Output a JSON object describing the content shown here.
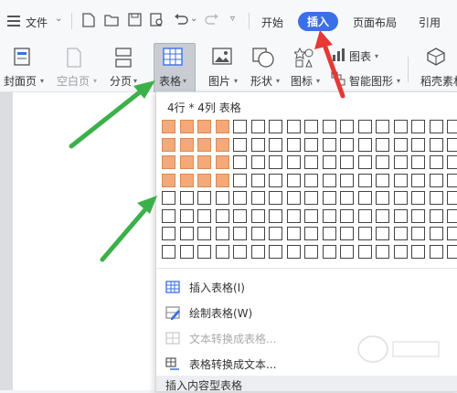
{
  "menubar": {
    "hamburger_icon": "hamburger-icon",
    "file_label": "文件",
    "tabs": [
      {
        "label": "开始",
        "active": false
      },
      {
        "label": "插入",
        "active": true
      },
      {
        "label": "页面布局",
        "active": false
      },
      {
        "label": "引用",
        "active": false
      }
    ]
  },
  "ribbon": {
    "items": [
      {
        "label": "封面页",
        "disabled": false,
        "icon": "cover-page-icon",
        "dropdown": true
      },
      {
        "label": "空白页",
        "disabled": true,
        "icon": "blank-page-icon",
        "dropdown": true
      },
      {
        "label": "分页",
        "disabled": false,
        "icon": "page-break-icon",
        "dropdown": true
      },
      {
        "label": "表格",
        "disabled": false,
        "icon": "table-icon",
        "dropdown": true,
        "selected": true
      },
      {
        "label": "图片",
        "disabled": false,
        "icon": "picture-icon",
        "dropdown": true
      },
      {
        "label": "形状",
        "disabled": false,
        "icon": "shape-icon",
        "dropdown": true
      },
      {
        "label": "图标",
        "disabled": false,
        "icon": "icon-library-icon",
        "dropdown": true
      },
      {
        "label": "图表",
        "disabled": false,
        "icon": "chart-icon",
        "dropdown": true
      },
      {
        "label": "智能图形",
        "disabled": false,
        "icon": "smart-art-icon",
        "dropdown": true
      },
      {
        "label": "稻壳素材",
        "disabled": false,
        "icon": "material-icon",
        "dropdown": false
      }
    ]
  },
  "table_dropdown": {
    "header": "4行 * 4列 表格",
    "grid": {
      "rows": 8,
      "cols": 17,
      "selected_rows": 4,
      "selected_cols": 4
    },
    "menu_items": [
      {
        "label": "插入表格(I)",
        "disabled": false,
        "icon": "insert-table-icon"
      },
      {
        "label": "绘制表格(W)",
        "disabled": false,
        "icon": "draw-table-icon"
      },
      {
        "label": "文本转换成表格...",
        "disabled": true,
        "icon": "text-to-table-icon"
      },
      {
        "label": "表格转换成文本...",
        "disabled": false,
        "icon": "table-to-text-icon"
      }
    ],
    "section_label": "插入内容型表格"
  },
  "colors": {
    "accent": "#3b6fe8",
    "grid_selected": "#f5a878",
    "red_arrow": "#e53935",
    "green_arrow": "#3cb04a"
  }
}
